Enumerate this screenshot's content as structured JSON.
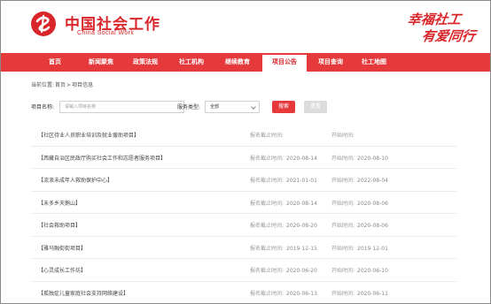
{
  "header": {
    "logo_cn": "中国社会工作",
    "logo_en": "China Social Work",
    "slogan_line1": "幸福社工",
    "slogan_line2": "有爱同行"
  },
  "nav": {
    "items": [
      {
        "label": "首页"
      },
      {
        "label": "新闻聚焦"
      },
      {
        "label": "政策法规"
      },
      {
        "label": "社工机构"
      },
      {
        "label": "继续教育"
      },
      {
        "label": "项目公告"
      },
      {
        "label": "项目查询"
      },
      {
        "label": "社工地图"
      }
    ],
    "active_index": 5
  },
  "breadcrumb": {
    "prefix": "当前位置:",
    "home": "首页",
    "separator": ">",
    "current": "项目信息"
  },
  "filter": {
    "name_label": "项目名称:",
    "name_placeholder": "请输入项目名称",
    "type_label": "服务类型:",
    "type_value": "全部",
    "search_label": "搜索",
    "reset_label": "重置"
  },
  "list": {
    "deadline_label": "报名截止时间:",
    "start_label": "开始时间:",
    "rows": [
      {
        "title": "【社区待业人员职业培训及就业援助项目】",
        "deadline": "",
        "start": ""
      },
      {
        "title": "【西藏自治区民政厅购买社会工作和志愿者服务项目】",
        "deadline": "2020-08-14",
        "start": "2020-08-10"
      },
      {
        "title": "【流浪未成年人救助保护中心】",
        "deadline": "2021-01-01",
        "start": "2022-08-04"
      },
      {
        "title": "【未多乡天鹅山】",
        "deadline": "2020-08-14",
        "start": "2020-08-06"
      },
      {
        "title": "【社会救助项目】",
        "deadline": "2020-08-20",
        "start": "2020-08-06"
      },
      {
        "title": "【雅马融街街项目】",
        "deadline": "2019-12-15",
        "start": "2019-12-01"
      },
      {
        "title": "【心灵成长工作坊】",
        "deadline": "2020-06-20",
        "start": "2020-06-10"
      },
      {
        "title": "【孤独症儿童家庭社会支持网络建设】",
        "deadline": "2020-06-13",
        "start": "2020-06-11"
      }
    ]
  },
  "colors": {
    "brand_red": "#e5393b",
    "text_red": "#d9262a"
  }
}
